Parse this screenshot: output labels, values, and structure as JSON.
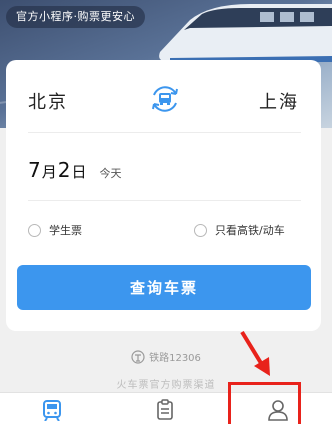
{
  "banner": {
    "badge_text": "官方小程序·购票更安心"
  },
  "search": {
    "from_station": "北京",
    "to_station": "上海",
    "date_month": "7",
    "month_unit": "月",
    "date_day": "2",
    "day_unit": "日",
    "date_note": "今天",
    "option_student": "学生票",
    "option_highspeed": "只看高铁/动车",
    "search_button": "查询车票"
  },
  "footer": {
    "brand_name": "铁路12306",
    "brand_slogan": "火车票官方购票渠道"
  },
  "tabbar": {
    "tabs": [
      {
        "icon": "train-ticket-icon",
        "active": true
      },
      {
        "icon": "order-list-icon",
        "active": false
      },
      {
        "icon": "user-profile-icon",
        "active": false
      }
    ]
  },
  "colors": {
    "primary": "#3c96ee",
    "annotation": "#e8221b",
    "background": "#f0f0f0"
  }
}
